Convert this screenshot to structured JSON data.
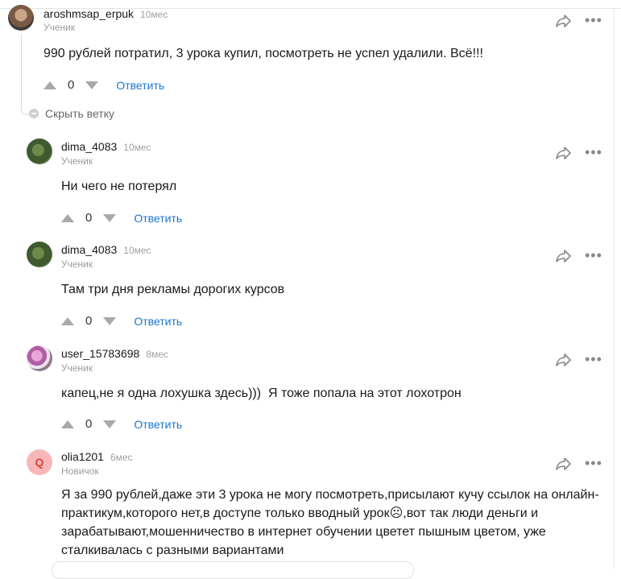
{
  "comments": [
    {
      "username": "aroshmsap_erpuk",
      "time": "10мес",
      "role": "Ученик",
      "text": "990 рублей потратил, 3 урока купил, посмотреть не успел удалили. Всё!!!",
      "votes": "0",
      "reply": "Ответить",
      "avatar": "photo-man-avatar"
    },
    {
      "username": "dima_4083",
      "time": "10мес",
      "role": "Ученик",
      "text": "Ни чего не потерял",
      "votes": "0",
      "reply": "Ответить",
      "avatar": "photo-plant-avatar"
    },
    {
      "username": "dima_4083",
      "time": "10мес",
      "role": "Ученик",
      "text": "Там три дня рекламы дорогих курсов",
      "votes": "0",
      "reply": "Ответить",
      "avatar": "photo-plant-avatar"
    },
    {
      "username": "user_15783698",
      "time": "8мес",
      "role": "Ученик",
      "text": "капец,не я одна лохушка здесь)))  Я тоже попала на этот лохотрон",
      "votes": "0",
      "reply": "Ответить",
      "avatar": "photo-flowers-avatar"
    },
    {
      "username": "olia1201",
      "time": "6мес",
      "role": "Новичок",
      "text": "Я за 990 рублей,даже эти 3 урока не могу посмотреть,присылают кучу ссылок на онлайн-практикум,которого нет,в доступе только вводный урок☹,вот так люди деньги и зарабатывают,мошенничество в интернет обучении цветет пышным цветом, уже сталкивалась с разными вариантами",
      "avatar_letter": "Q",
      "avatar_color": "#f7b7b7"
    }
  ],
  "hide_branch": "Скрыть ветку",
  "colors": {
    "accent": "#1976d2",
    "muted": "#a0a0a0"
  }
}
